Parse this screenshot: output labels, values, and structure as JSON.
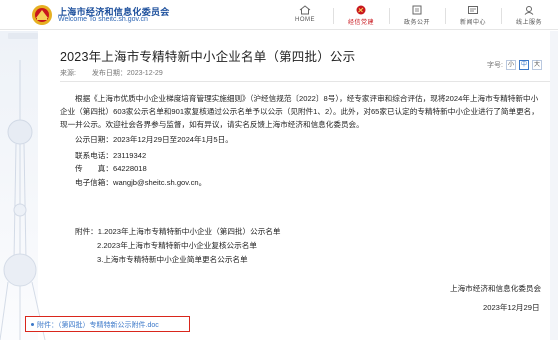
{
  "header": {
    "site_title": "上海市经济和信息化委员会",
    "site_subtitle": "Welcome To sheitc.sh.gov.cn",
    "nav": [
      {
        "label": "HOME",
        "icon": "home-icon"
      },
      {
        "label": "经信党建",
        "icon": "party-emblem-icon"
      },
      {
        "label": "政务公开",
        "icon": "government-affairs-icon"
      },
      {
        "label": "新闻中心",
        "icon": "news-icon"
      },
      {
        "label": "线上服务",
        "icon": "online-service-icon"
      }
    ],
    "active_nav_index": 1,
    "brand_color": "#1c4f9c",
    "accent_color": "#c8161d"
  },
  "article": {
    "title": "2023年上海市专精特新中小企业名单（第四批）公示",
    "source_label": "来源:",
    "publish_label": "发布日期：2023-12-29",
    "fontsize_label": "字号:",
    "fontsize_options": [
      "小",
      "中",
      "大"
    ],
    "fontsize_selected": "中",
    "body": "根据《上海市优质中小企业梯度培育管理实施细则》（沪经信规范〔2022〕8号），经专家评审和综合评估，现将2024年上海市专精特新中小企业（第四批）603家公示名单和901家复核通过公示名单予以公示（见附件1、2）。此外，对65家已认定的专精特新中小企业进行了简单更名，现一并公示。欢迎社会各界参与监督，如有异议，请实名反馈上海市经济和信息化委员会。",
    "period": "公示日期：2023年12月29日至2024年1月5日。",
    "phone": "联系电话：23119342",
    "fax": "传　　真：64228018",
    "email": "电子信箱：wangjb@sheitc.sh.gov.cn。",
    "attachments_label": "附件：",
    "attachments": [
      "1.2023年上海市专精特新中小企业（第四批）公示名单",
      "2.2023年上海市专精特新中小企业复核公示名单",
      "3.上海市专精特新中小企业简单更名公示名单"
    ],
    "signature": "上海市经济和信息化委员会",
    "date": "2023年12月29日",
    "file_link": "附件：（第四批）专精特新公示附件.doc",
    "link_color": "#3b78c9"
  }
}
